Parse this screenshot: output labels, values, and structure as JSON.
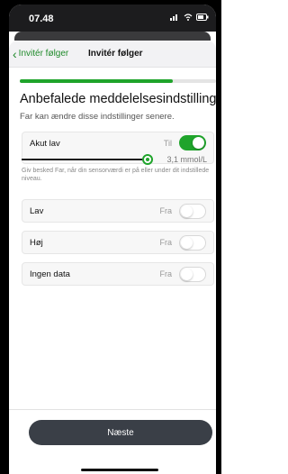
{
  "status_bar": {
    "time": "07.48",
    "icons": "signal wifi battery"
  },
  "nav": {
    "back_label": "Invitér følger",
    "title": "Invitér følger"
  },
  "progress": {
    "fraction": 0.78,
    "color": "#1fa42b"
  },
  "page": {
    "heading": "Anbefalede meddelelsesindstillinger.",
    "subheading": "Far kan ændre disse indstillinger senere."
  },
  "alerts": {
    "akut_lav": {
      "label": "Akut lav",
      "state": "Til",
      "enabled": true,
      "value": "3,1 mmol/L",
      "hint": "Giv besked Far, når din sensorværdi er på eller under dit indstillede niveau."
    },
    "lav": {
      "label": "Lav",
      "state": "Fra",
      "enabled": false
    },
    "hoj": {
      "label": "Høj",
      "state": "Fra",
      "enabled": false
    },
    "ingen_data": {
      "label": "Ingen data",
      "state": "Fra",
      "enabled": false
    }
  },
  "footer": {
    "next_label": "Næste"
  },
  "colors": {
    "accent": "#1fa42b",
    "back_text": "#1f8a2a",
    "button": "#3a3f47"
  }
}
